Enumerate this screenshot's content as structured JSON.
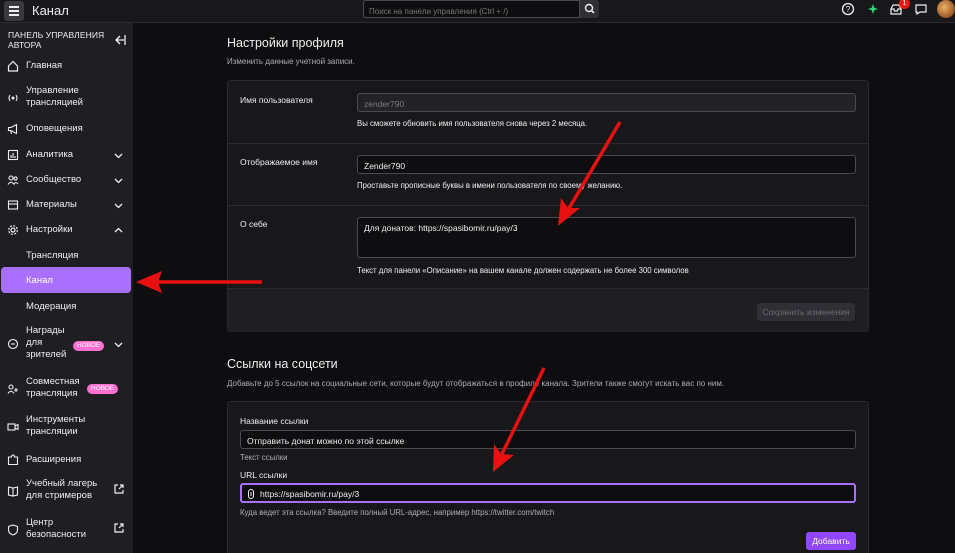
{
  "topbar": {
    "title": "Канал",
    "search_placeholder": "Поиск на панели управления (Ctrl + /)",
    "notification_count": "1",
    "icons": [
      "menu-icon",
      "search-icon",
      "help-icon",
      "sparkle-icon",
      "inbox-icon",
      "whisper-icon",
      "avatar"
    ]
  },
  "sidebar": {
    "header": "ПАНЕЛЬ УПРАВЛЕНИЯ АВТОРА",
    "items": [
      {
        "label": "Главная",
        "icon": "home-icon"
      },
      {
        "label": "Управление трансляцией",
        "icon": "broadcast-icon"
      },
      {
        "label": "Оповещения",
        "icon": "megaphone-icon"
      },
      {
        "label": "Аналитика",
        "icon": "chart-icon"
      },
      {
        "label": "Сообщество",
        "icon": "community-icon"
      },
      {
        "label": "Материалы",
        "icon": "content-icon"
      },
      {
        "label": "Настройки",
        "icon": "gear-icon"
      },
      {
        "label": "Трансляция"
      },
      {
        "label": "Канал"
      },
      {
        "label": "Модерация"
      },
      {
        "label": "Награды для зрителей",
        "icon": "rewards-icon",
        "badge": "НОВОЕ"
      },
      {
        "label": "Совместная трансляция",
        "icon": "collab-icon",
        "badge": "НОВОЕ"
      },
      {
        "label": "Инструменты трансляции",
        "icon": "camera-icon"
      },
      {
        "label": "Расширения",
        "icon": "puzzle-icon"
      },
      {
        "label": "Учебный лагерь для стримеров",
        "icon": "book-icon"
      },
      {
        "label": "Центр безопасности",
        "icon": "shield-icon"
      }
    ]
  },
  "profile": {
    "title": "Настройки профиля",
    "desc": "Изменить данные учетной записи.",
    "username_label": "Имя пользователя",
    "username_value": "zender790",
    "username_hint": "Вы сможете обновить имя пользователя снова через 2 месяца.",
    "display_label": "Отображаемое имя",
    "display_value": "Zender790",
    "display_hint": "Проставьте прописные буквы в имени пользователя по своему желанию.",
    "bio_label": "О себе",
    "bio_value": "Для донатов: https://spasibomir.ru/pay/3",
    "bio_hint": "Текст для панели «Описание» на вашем канале должен содержать не более 300 символов",
    "save_label": "Сохранить изменения"
  },
  "social": {
    "title": "Ссылки на соцсети",
    "desc": "Добавьте до 5 ссылок на социальные сети, которые будут отображаться в профиле канала. Зрители также смогут искать вас по ним.",
    "name_label": "Название ссылки",
    "name_value": "Отправить донат можно по этой ссылке",
    "name_hint": "Текст ссылки",
    "url_label": "URL ссылки",
    "url_value": "https://spasibomir.ru/pay/3",
    "url_hint": "Куда ведет эта ссылка? Введите полный URL-адрес, например https://twitter.com/twitch",
    "add_label": "Добавить"
  },
  "colors": {
    "accent": "#9147ff",
    "active_nav": "#a970ff",
    "badge": "#ff6fcf",
    "arrow": "#e81010"
  }
}
